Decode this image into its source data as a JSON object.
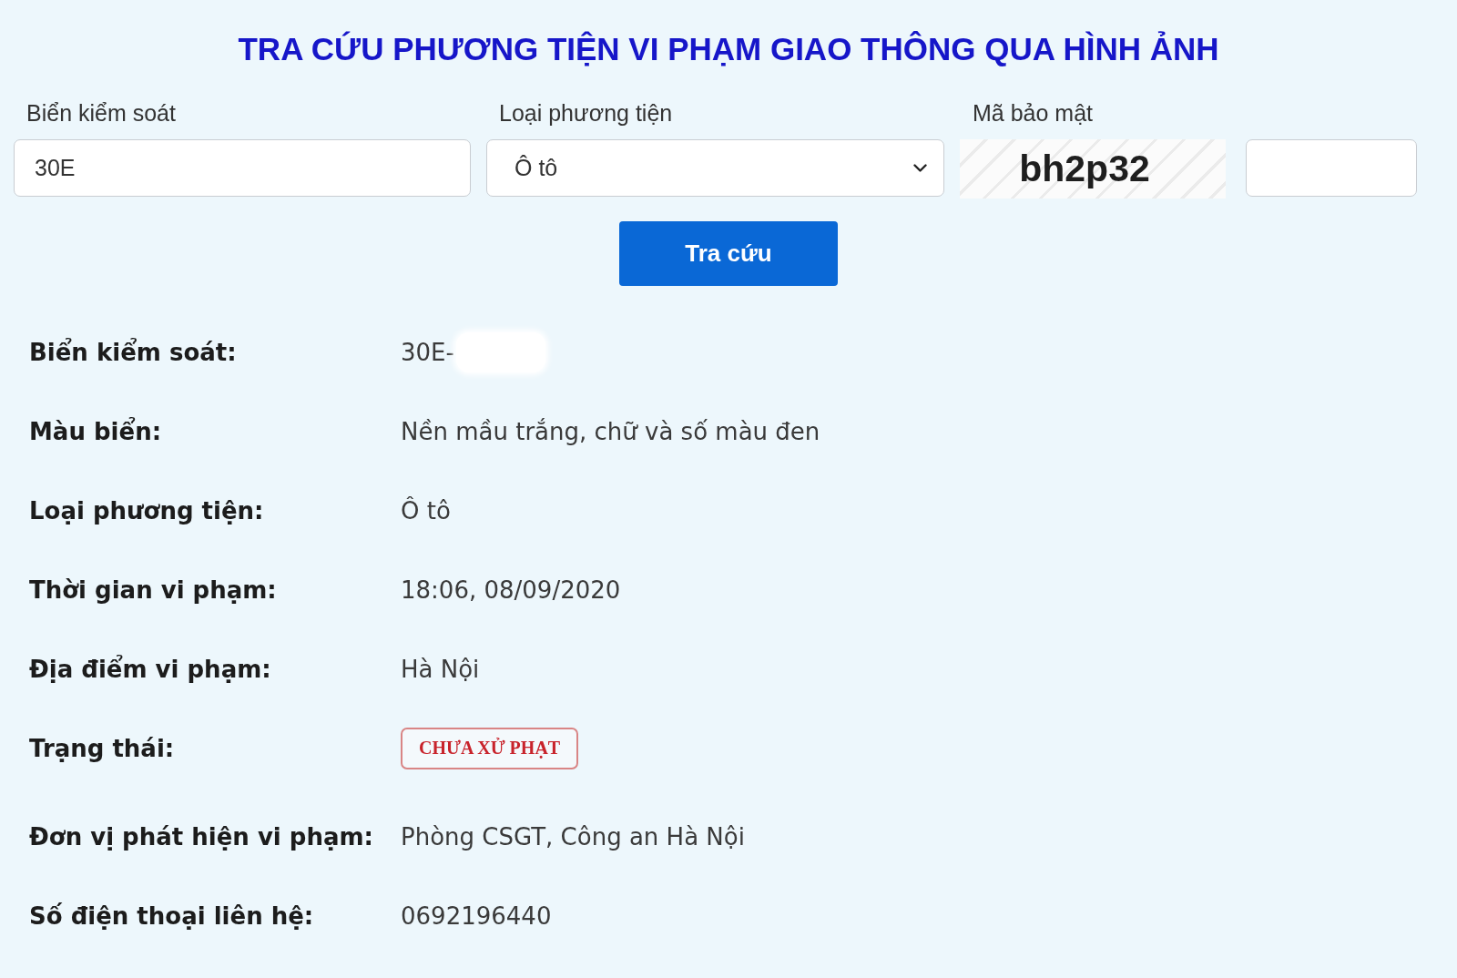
{
  "title": "TRA CỨU PHƯƠNG TIỆN VI PHẠM GIAO THÔNG QUA HÌNH ẢNH",
  "form": {
    "plate": {
      "label": "Biển kiểm soát",
      "value": "30E"
    },
    "vehicle_type": {
      "label": "Loại phương tiện",
      "value": "Ô tô"
    },
    "captcha": {
      "label": "Mã bảo mật",
      "code": "bh2p32"
    },
    "submit": "Tra cứu"
  },
  "details": [
    {
      "kind": "text",
      "label": "Biển kiểm soát:",
      "value": "30E-",
      "redacted": true
    },
    {
      "kind": "text",
      "label": "Màu biển:",
      "value": "Nền mầu trắng, chữ và số màu đen",
      "redacted": false
    },
    {
      "kind": "text",
      "label": "Loại phương tiện:",
      "value": "Ô tô",
      "redacted": false
    },
    {
      "kind": "text",
      "label": "Thời gian vi phạm:",
      "value": "18:06, 08/09/2020",
      "redacted": false
    },
    {
      "kind": "text",
      "label": "Địa điểm vi phạm:",
      "value": "Hà Nội",
      "redacted": false
    },
    {
      "kind": "badge",
      "label": "Trạng thái:",
      "value": "CHƯA XỬ PHẠT",
      "redacted": false
    },
    {
      "kind": "text",
      "label": "Đơn vị phát hiện vi phạm:",
      "value": "Phòng CSGT, Công an Hà Nội",
      "redacted": false
    },
    {
      "kind": "text",
      "label": "Số điện thoại liên hệ:",
      "value": "0692196440",
      "redacted": false
    }
  ]
}
